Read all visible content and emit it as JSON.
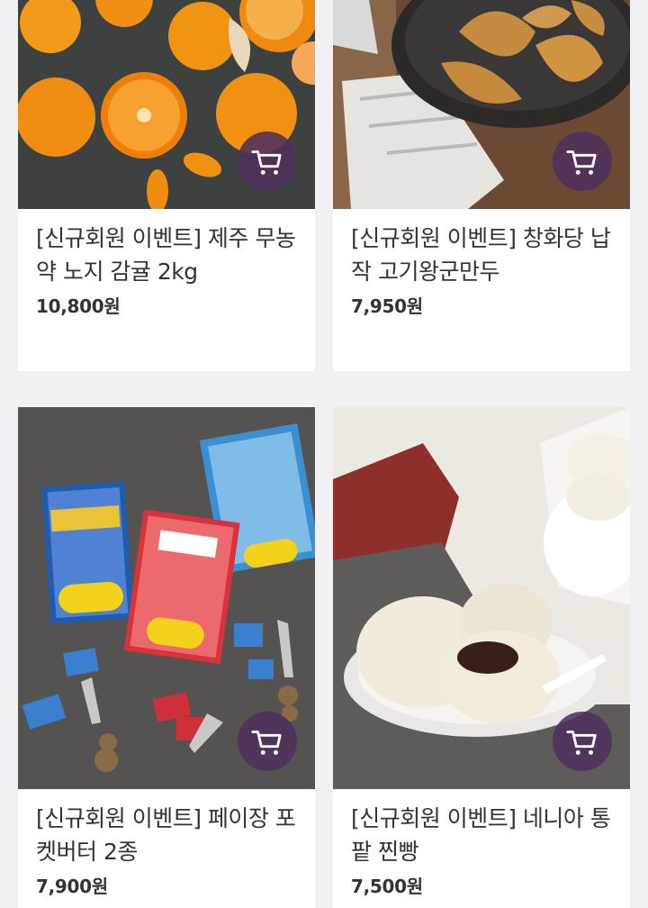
{
  "products": [
    {
      "name": "[신규회원 이벤트] 제주 무농약 노지 감귤 2kg",
      "price": "10,800원",
      "image": "mandarin oranges",
      "cart_icon": "cart-icon"
    },
    {
      "name": "[신규회원 이벤트] 창화당 납작 고기왕군만두",
      "price": "7,950원",
      "image": "pan-fried dumplings",
      "cart_icon": "cart-icon"
    },
    {
      "name": "[신규회원 이벤트] 페이장 포켓버터 2종",
      "price": "7,900원",
      "image": "butter packs",
      "cart_icon": "cart-icon"
    },
    {
      "name": "[신규회원 이벤트] 네니아 통팥 찐빵",
      "price": "7,500원",
      "image": "red bean steamed buns",
      "cart_icon": "cart-icon"
    }
  ],
  "colors": {
    "background": "#f1f1f3",
    "card": "#ffffff",
    "cart_button": "#4e305c",
    "text": "#333333"
  }
}
